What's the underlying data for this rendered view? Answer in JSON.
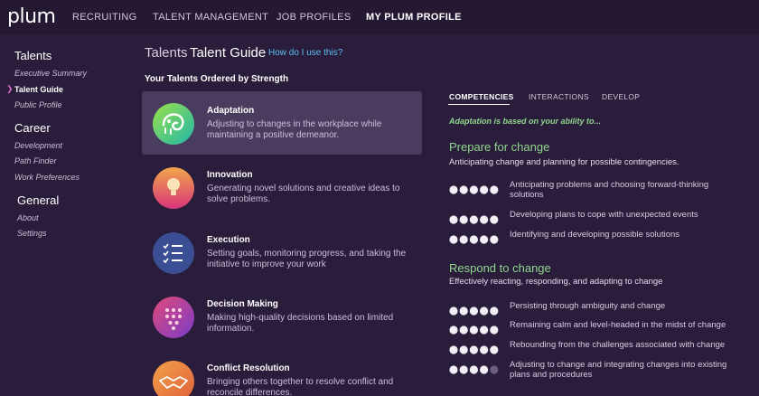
{
  "app": {
    "logo": "plum"
  },
  "topnav": {
    "items": [
      {
        "label": "RECRUITING",
        "active": false
      },
      {
        "label": "TALENT MANAGEMENT",
        "active": false
      },
      {
        "label": "JOB PROFILES",
        "active": false
      },
      {
        "label": "MY PLUM PROFILE",
        "active": true
      }
    ]
  },
  "sidebar": {
    "groups": [
      {
        "label": "Talents",
        "items": [
          {
            "label": "Executive Summary",
            "active": false
          },
          {
            "label": "Talent Guide",
            "active": true
          },
          {
            "label": "Public Profile",
            "active": false
          }
        ]
      },
      {
        "label": "Career",
        "items": [
          {
            "label": "Development",
            "active": false
          },
          {
            "label": "Path Finder",
            "active": false
          },
          {
            "label": "Work Preferences",
            "active": false
          }
        ]
      },
      {
        "label": "General",
        "items": [
          {
            "label": "About",
            "active": false
          },
          {
            "label": "Settings",
            "active": false
          }
        ]
      }
    ]
  },
  "page": {
    "title_prefix": "Talents",
    "title": "Talent Guide",
    "help_link": "How do I use this?",
    "ordered_heading": "Your Talents Ordered by Strength"
  },
  "talents": [
    {
      "name": "Adaptation",
      "description": "Adjusting to changes in the workplace while maintaining a positive demeanor.",
      "icon": "chameleon-icon",
      "selected": true
    },
    {
      "name": "Innovation",
      "description": "Generating novel solutions and creative ideas to solve problems.",
      "icon": "lightbulb-icon",
      "selected": false
    },
    {
      "name": "Execution",
      "description": "Setting goals, monitoring progress, and taking the initiative to improve your work",
      "icon": "checklist-icon",
      "selected": false
    },
    {
      "name": "Decision Making",
      "description": "Making high-quality decisions based on limited information.",
      "icon": "decision-tree-icon",
      "selected": false
    },
    {
      "name": "Conflict Resolution",
      "description": "Bringing others together to resolve conflict and reconcile differences.",
      "icon": "handshake-icon",
      "selected": false
    }
  ],
  "detail": {
    "tabs": [
      {
        "label": "COMPETENCIES",
        "active": true
      },
      {
        "label": "INTERACTIONS",
        "active": false
      },
      {
        "label": "DEVELOP",
        "active": false
      }
    ],
    "based_on": "Adaptation is based on your ability to...",
    "sections": [
      {
        "title": "Prepare for change",
        "subtitle": "Anticipating change and planning for possible contingencies.",
        "competencies": [
          {
            "text": "Anticipating problems and choosing forward-thinking solutions",
            "score": 5
          },
          {
            "text": "Developing plans to cope with unexpected events",
            "score": 5
          },
          {
            "text": "Identifying and developing possible solutions",
            "score": 5
          }
        ]
      },
      {
        "title": "Respond to change",
        "subtitle": "Effectively reacting, responding, and adapting to change",
        "competencies": [
          {
            "text": "Persisting through ambiguity and change",
            "score": 5
          },
          {
            "text": "Remaining calm and level-headed in the midst of change",
            "score": 5
          },
          {
            "text": "Rebounding from the challenges associated with change",
            "score": 5
          },
          {
            "text": "Adjusting to change and integrating changes into existing plans and procedures",
            "score": 4
          }
        ]
      }
    ]
  },
  "colors": {
    "background": "#2a1c3b",
    "accent_green": "#8fd68c",
    "link_blue": "#5bc0f0",
    "selected_card": "#4a3c5e"
  }
}
